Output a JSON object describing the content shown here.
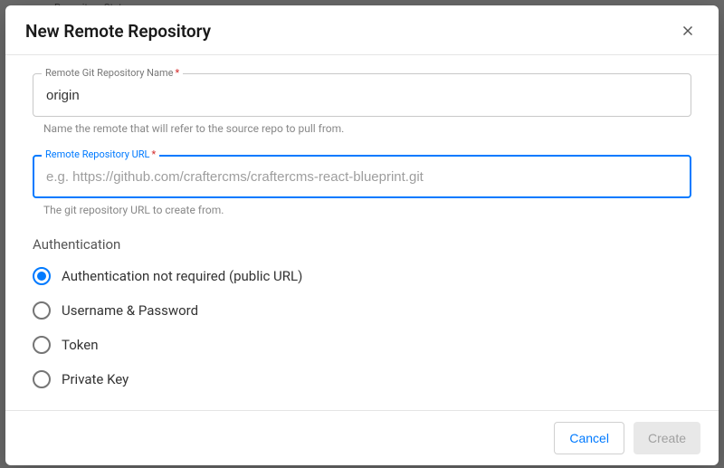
{
  "dialog": {
    "title": "New Remote Repository"
  },
  "fields": {
    "repoName": {
      "label": "Remote Git Repository Name",
      "value": "origin",
      "placeholder": "",
      "helper": "Name the remote that will refer to the source repo to pull from."
    },
    "repoUrl": {
      "label": "Remote Repository URL",
      "value": "",
      "placeholder": "e.g. https://github.com/craftercms/craftercms-react-blueprint.git",
      "helper": "The git repository URL to create from."
    }
  },
  "auth": {
    "heading": "Authentication",
    "options": [
      {
        "label": "Authentication not required (public URL)",
        "checked": true
      },
      {
        "label": "Username & Password",
        "checked": false
      },
      {
        "label": "Token",
        "checked": false
      },
      {
        "label": "Private Key",
        "checked": false
      }
    ]
  },
  "footer": {
    "cancel": "Cancel",
    "create": "Create"
  },
  "backdrop": {
    "hint": "Repository Status"
  }
}
